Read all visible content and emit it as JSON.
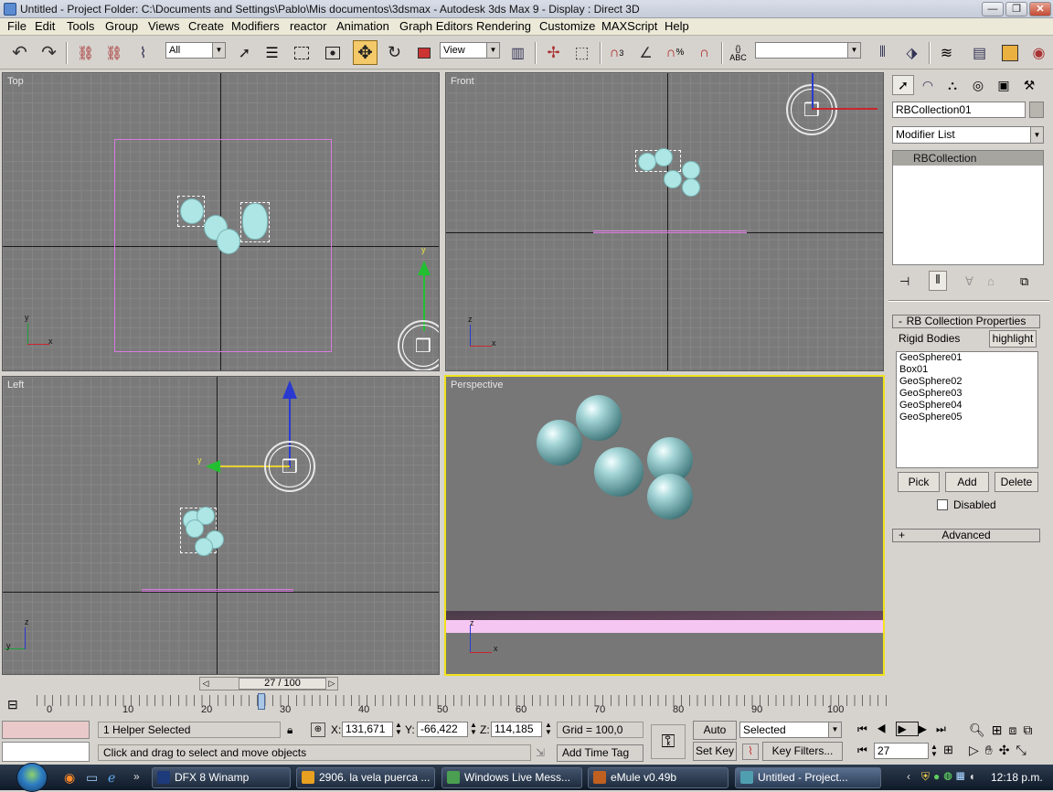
{
  "titlebar": {
    "title": "Untitled     - Project Folder: C:\\Documents and Settings\\Pablo\\Mis documentos\\3dsmax     - Autodesk 3ds Max 9     - Display : Direct 3D",
    "minimize": "—",
    "maximize": "❐",
    "close": "✕"
  },
  "menu": [
    "File",
    "Edit",
    "Tools",
    "Group",
    "Views",
    "Create",
    "Modifiers",
    "reactor",
    "Animation",
    "Graph Editors",
    "Rendering",
    "Customize",
    "MAXScript",
    "Help"
  ],
  "toolbar": {
    "selection_filter": "All",
    "ref_coord": "View",
    "named_sel": "",
    "snap_label": "3",
    "percent_label": "%",
    "abc_label": "ABC"
  },
  "viewports": {
    "top": {
      "label": "Top",
      "axis_x": "x",
      "axis_y": "y",
      "gizmo_axis": "y"
    },
    "front": {
      "label": "Front",
      "axis_x": "x",
      "axis_z": "z"
    },
    "left": {
      "label": "Left",
      "axis_y": "y",
      "axis_z": "z",
      "gizmo_axis": "y"
    },
    "perspective": {
      "label": "Perspective",
      "axis_x": "x",
      "axis_z": "z"
    }
  },
  "command_panel": {
    "object_name": "RBCollection01",
    "modifier_list": "Modifier List",
    "stack": [
      "RBCollection"
    ],
    "rollout_title": "RB Collection Properties",
    "rollout_toggle": "-",
    "rigid_bodies_label": "Rigid Bodies",
    "highlight_button": "highlight",
    "bodies": [
      "GeoSphere01",
      "Box01",
      "GeoSphere02",
      "GeoSphere03",
      "GeoSphere04",
      "GeoSphere05"
    ],
    "pick_button": "Pick",
    "add_button": "Add",
    "delete_button": "Delete",
    "disabled_label": "Disabled",
    "disabled_checked": false,
    "advanced_title": "Advanced",
    "advanced_toggle": "+"
  },
  "timeline": {
    "frame_slider": "27 / 100",
    "current_frame": 27,
    "total_frames": 100,
    "ticks": [
      "0",
      "10",
      "20",
      "30",
      "40",
      "50",
      "60",
      "70",
      "80",
      "90",
      "100"
    ]
  },
  "status": {
    "selection_info": "1 Helper Selected",
    "prompt": "Click and drag to select and move objects",
    "x_label": "X:",
    "x_value": "131,671",
    "y_label": "Y:",
    "y_value": "-66,422",
    "z_label": "Z:",
    "z_value": "114,185",
    "grid": "Grid = 100,0",
    "add_time_tag": "Add Time Tag",
    "auto_key": "Auto Key",
    "set_key": "Set Key",
    "key_mode": "Selected",
    "key_filters": "Key Filters...",
    "frame_field": "27"
  },
  "taskbar": {
    "items": [
      "DFX 8 Winamp",
      "2906. la vela puerca ...",
      "Windows Live Mess...",
      "eMule v0.49b",
      "Untitled     - Project..."
    ],
    "time": "12:18 p.m."
  }
}
